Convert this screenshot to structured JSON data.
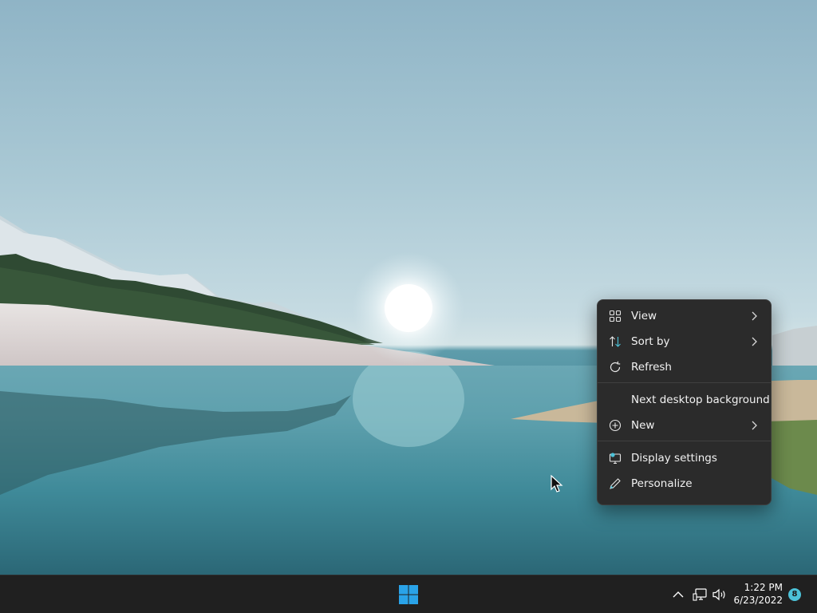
{
  "context_menu": {
    "items": [
      {
        "label": "View",
        "icon": "grid-view-icon",
        "submenu": true
      },
      {
        "label": "Sort by",
        "icon": "sort-arrows-icon",
        "submenu": true
      },
      {
        "label": "Refresh",
        "icon": "refresh-icon",
        "submenu": false
      },
      {
        "label": "Next desktop background",
        "icon": "",
        "submenu": false
      },
      {
        "label": "New",
        "icon": "plus-circle-icon",
        "submenu": true
      },
      {
        "label": "Display settings",
        "icon": "display-settings-icon",
        "submenu": false
      },
      {
        "label": "Personalize",
        "icon": "pen-icon",
        "submenu": false
      }
    ]
  },
  "taskbar": {
    "start_icon": "windows-logo-icon",
    "tray_icons": [
      "chevron-up-icon",
      "network-icon",
      "volume-icon"
    ],
    "clock": {
      "time": "1:22 PM",
      "date": "6/23/2022"
    },
    "notification_count": "8"
  },
  "colors": {
    "menu_bg": "#2b2b2b",
    "taskbar_bg": "#202020",
    "accent": "#4cc2d8",
    "start_blue": "#2aa3e8"
  }
}
